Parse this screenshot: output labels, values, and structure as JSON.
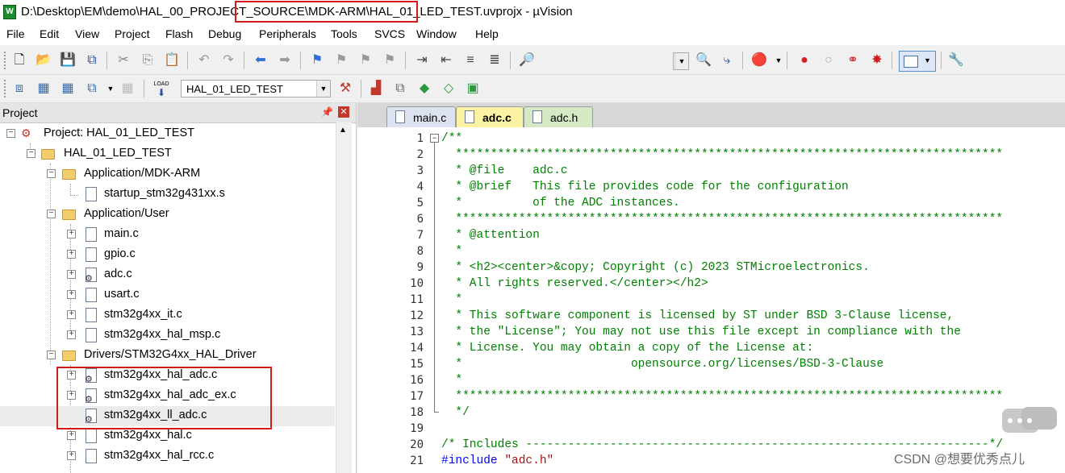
{
  "window": {
    "title_prefix": "D:\\Desktop\\EM\\demo\\HAL_00_PROJ",
    "title_highlight": "ECT_SOURCE\\MDK-ARM\\HAL_0",
    "title_suffix": "1_LED_TEST.uvprojx - µVision",
    "app_icon": "W"
  },
  "menu": [
    "File",
    "Edit",
    "View",
    "Project",
    "Flash",
    "Debug",
    "Peripherals",
    "Tools",
    "SVCS",
    "Window",
    "Help"
  ],
  "toolbar2": {
    "target": "HAL_01_LED_TEST",
    "load_label": "LOAD"
  },
  "project": {
    "header": "Project",
    "root": "Project: HAL_01_LED_TEST",
    "target": "HAL_01_LED_TEST",
    "groups": [
      {
        "name": "Application/MDK-ARM",
        "files": [
          "startup_stm32g431xx.s"
        ]
      },
      {
        "name": "Application/User",
        "files": [
          "main.c",
          "gpio.c",
          "adc.c",
          "usart.c",
          "stm32g4xx_it.c",
          "stm32g4xx_hal_msp.c"
        ]
      },
      {
        "name": "Drivers/STM32G4xx_HAL_Driver",
        "files": [
          "stm32g4xx_hal_adc.c",
          "stm32g4xx_hal_adc_ex.c",
          "stm32g4xx_ll_adc.c",
          "stm32g4xx_hal.c",
          "stm32g4xx_hal_rcc.c"
        ]
      }
    ]
  },
  "tabs": [
    {
      "label": "main.c",
      "active": false
    },
    {
      "label": "adc.c",
      "active": true
    },
    {
      "label": "adc.h",
      "active": false
    }
  ],
  "code": {
    "line_numbers": [
      "1",
      "2",
      "3",
      "4",
      "5",
      "6",
      "7",
      "8",
      "9",
      "10",
      "11",
      "12",
      "13",
      "14",
      "15",
      "16",
      "17",
      "18",
      "19",
      "20",
      "21"
    ],
    "lines": [
      "/**",
      "  ******************************************************************************",
      "  * @file    adc.c",
      "  * @brief   This file provides code for the configuration",
      "  *          of the ADC instances.",
      "  ******************************************************************************",
      "  * @attention",
      "  *",
      "  * <h2><center>&copy; Copyright (c) 2023 STMicroelectronics.",
      "  * All rights reserved.</center></h2>",
      "  *",
      "  * This software component is licensed by ST under BSD 3-Clause license,",
      "  * the \"License\"; You may not use this file except in compliance with the",
      "  * License. You may obtain a copy of the License at:",
      "  *                        opensource.org/licenses/BSD-3-Clause",
      "  *",
      "  ******************************************************************************",
      "  */",
      "",
      "/* Includes ------------------------------------------------------------------*/",
      "#include \"adc.h\""
    ]
  },
  "watermark": "CSDN @想要优秀点儿",
  "colors": {
    "comment": "#008000",
    "keyword": "#0000ff",
    "string": "#a31515",
    "highlight_box": "#d21a1a",
    "active_tab": "#fbf3a3"
  }
}
